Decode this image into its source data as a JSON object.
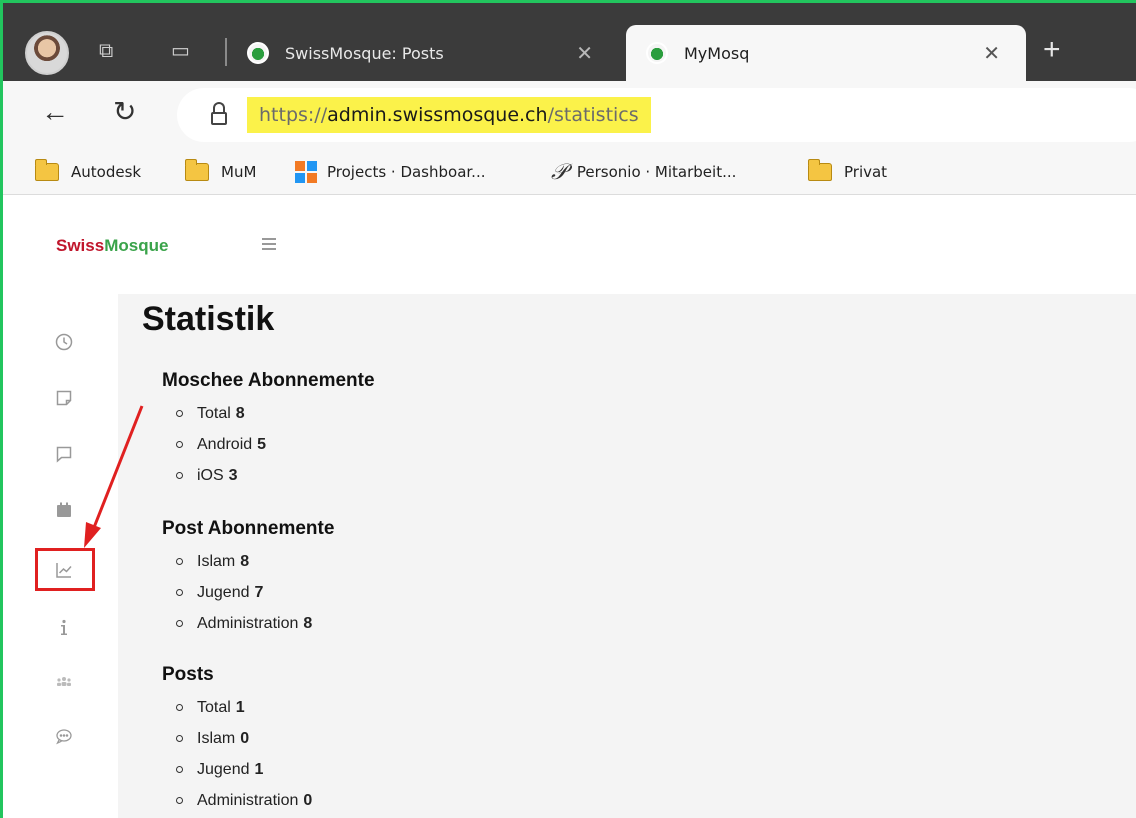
{
  "browser": {
    "tabs": [
      {
        "title": "SwissMosque: Posts",
        "active": false
      },
      {
        "title": "MyMosq",
        "active": true
      }
    ],
    "url": {
      "scheme": "https://",
      "host": "admin.swissmosque.ch",
      "path": "/statistics"
    },
    "bookmarks": [
      {
        "label": "Autodesk",
        "icon": "folder-icon"
      },
      {
        "label": "MuM",
        "icon": "folder-icon"
      },
      {
        "label": "Projects · Dashboar...",
        "icon": "projects-icon"
      },
      {
        "label": "Personio · Mitarbeit...",
        "icon": "personio-icon"
      },
      {
        "label": "Privat",
        "icon": "folder-icon"
      }
    ]
  },
  "app": {
    "logo_a": "Swiss",
    "logo_b": "Mosque",
    "sidebar_icons": [
      "clock-icon",
      "note-icon",
      "comment-icon",
      "calendar-icon",
      "chart-icon",
      "info-icon",
      "users-icon",
      "chat-icon"
    ],
    "active_sidebar": "chart-icon"
  },
  "page": {
    "title": "Statistik",
    "sections": [
      {
        "title": "Moschee Abonnemente",
        "items": [
          {
            "label": "Total",
            "value": "8"
          },
          {
            "label": "Android",
            "value": "5"
          },
          {
            "label": "iOS",
            "value": "3"
          }
        ]
      },
      {
        "title": "Post Abonnemente",
        "items": [
          {
            "label": "Islam",
            "value": "8"
          },
          {
            "label": "Jugend",
            "value": "7"
          },
          {
            "label": "Administration",
            "value": "8"
          }
        ]
      },
      {
        "title": "Posts",
        "items": [
          {
            "label": "Total",
            "value": "1"
          },
          {
            "label": "Islam",
            "value": "0"
          },
          {
            "label": "Jugend",
            "value": "1"
          },
          {
            "label": "Administration",
            "value": "0"
          }
        ]
      }
    ]
  },
  "colors": {
    "frame": "#22c55e",
    "annotation": "#e02020",
    "url_highlight": "#fbf24a"
  }
}
